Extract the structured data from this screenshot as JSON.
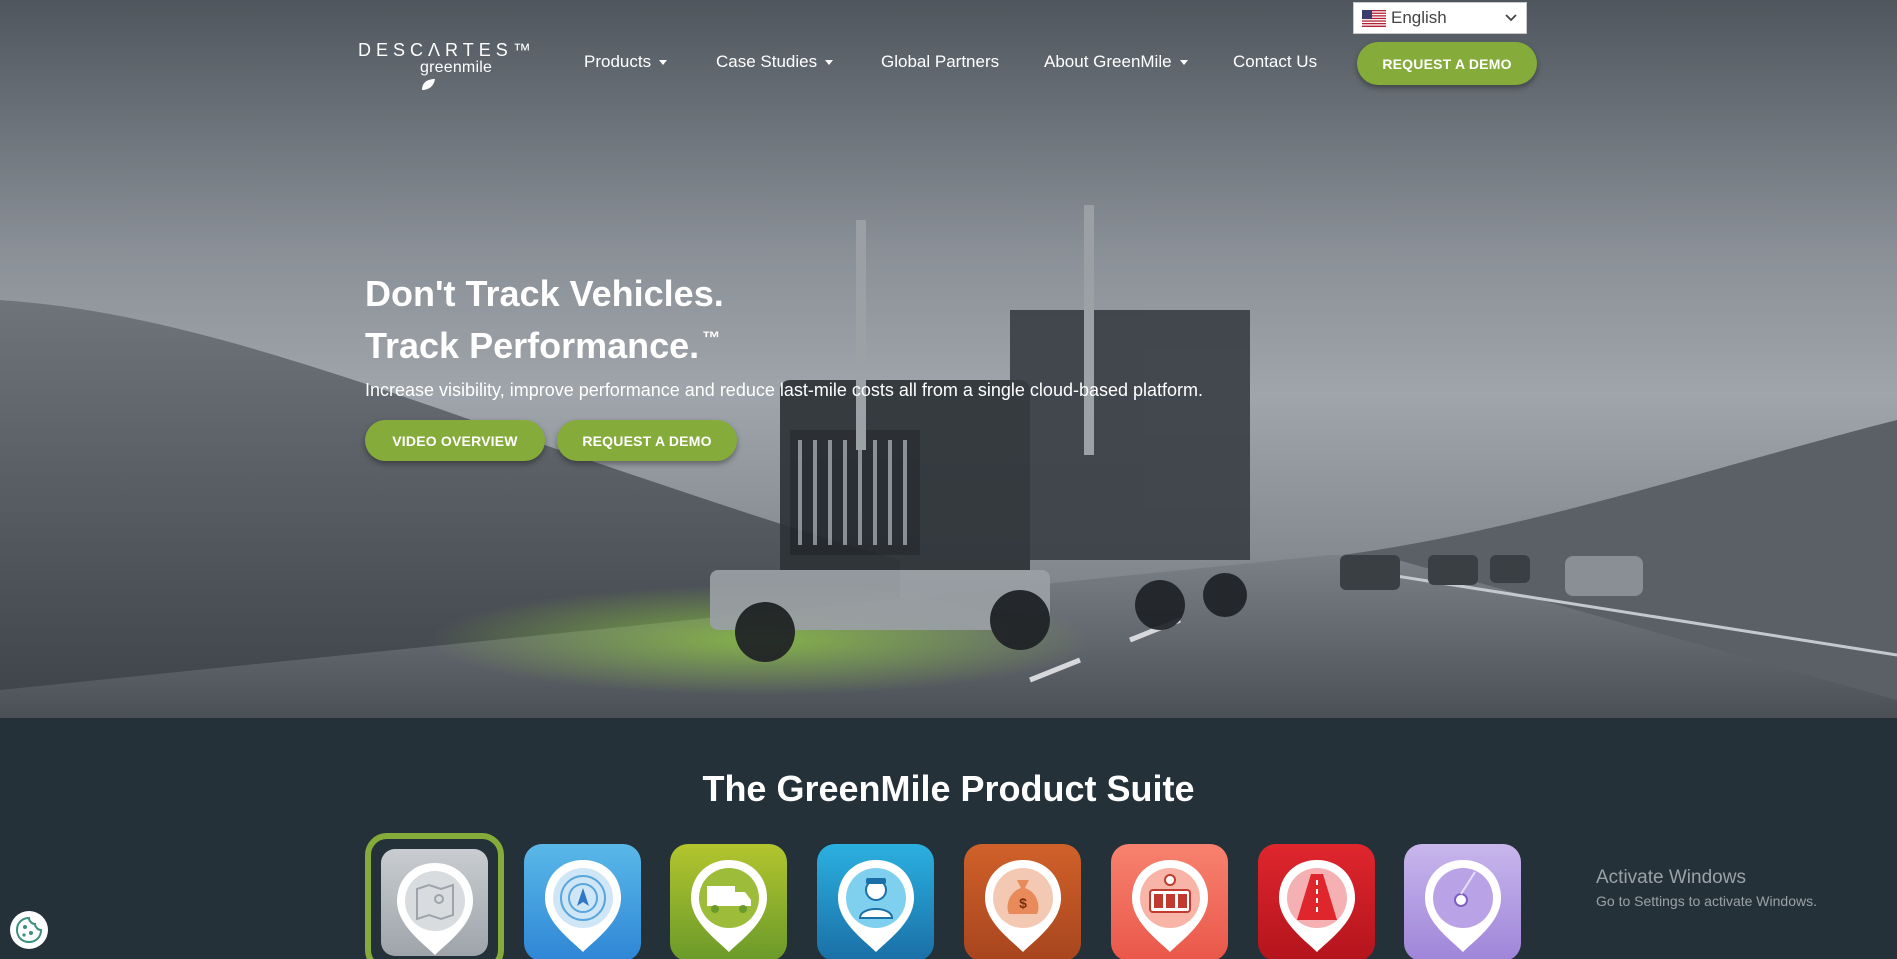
{
  "language_selector": {
    "value": "English",
    "icon": "us-flag-icon"
  },
  "logo": {
    "line1": "DESCΛRTES™",
    "line2": "greenmile"
  },
  "nav": {
    "items": [
      {
        "label": "Products",
        "has_dropdown": true
      },
      {
        "label": "Case Studies",
        "has_dropdown": true
      },
      {
        "label": "Global Partners",
        "has_dropdown": false
      },
      {
        "label": "About GreenMile",
        "has_dropdown": true
      },
      {
        "label": "Contact Us",
        "has_dropdown": false
      }
    ],
    "cta_label": "REQUEST A DEMO"
  },
  "hero": {
    "headline_line1": "Don't Track Vehicles.",
    "headline_line2": "Track Performance.",
    "trademark": "™",
    "subheadline": "Increase visibility, improve performance and reduce last-mile costs all from a single cloud-based platform.",
    "video_button": "VIDEO OVERVIEW",
    "demo_button": "REQUEST A DEMO"
  },
  "suite": {
    "title": "The GreenMile Product Suite",
    "tiles": [
      {
        "icon": "map-pin-icon",
        "color_top": "#c9cdd1",
        "color_bottom": "#9ea4aa",
        "selected": true
      },
      {
        "icon": "gps-navigation-icon",
        "color_top": "#5ab8e8",
        "color_bottom": "#2f86d6",
        "selected": false
      },
      {
        "icon": "delivery-truck-icon",
        "color_top": "#b3c52e",
        "color_bottom": "#6a9a2a",
        "selected": false
      },
      {
        "icon": "driver-person-icon",
        "color_top": "#2bb0e0",
        "color_bottom": "#1a6fa6",
        "selected": false
      },
      {
        "icon": "money-bag-icon",
        "color_top": "#d0612a",
        "color_bottom": "#a8451e",
        "selected": false
      },
      {
        "icon": "slot-machine-icon",
        "color_top": "#f8826f",
        "color_bottom": "#e9574a",
        "selected": false
      },
      {
        "icon": "road-icon",
        "color_top": "#e0262d",
        "color_bottom": "#b3141d",
        "selected": false
      },
      {
        "icon": "location-pin-icon",
        "color_top": "#c8b6ec",
        "color_bottom": "#9f85d9",
        "selected": false
      }
    ]
  },
  "watermark": {
    "line1": "Activate Windows",
    "line2": "Go to Settings to activate Windows."
  },
  "colors": {
    "accent_green": "#85ac3b",
    "dark_bg": "#253139"
  }
}
